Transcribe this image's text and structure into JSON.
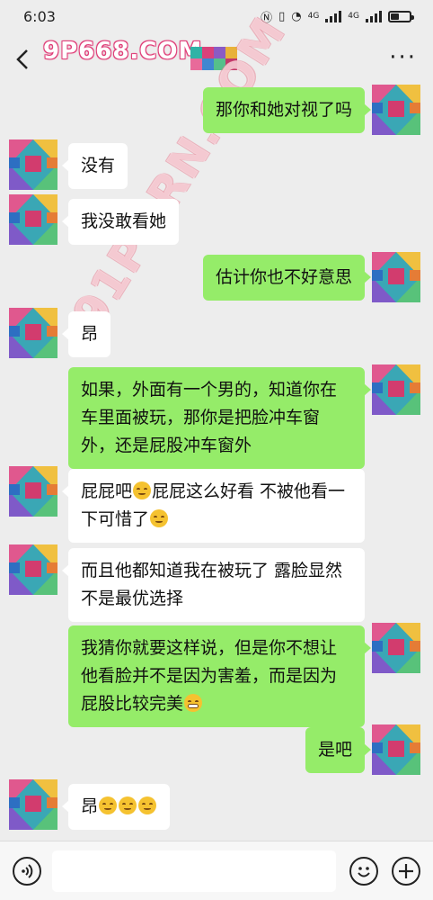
{
  "status_bar": {
    "time": "6:03",
    "icons": [
      "nfc-icon",
      "vibrate-icon",
      "wifi-icon",
      "4g-signal-icon",
      "4g-signal-icon",
      "battery-icon"
    ],
    "net_label_1": "4G",
    "net_label_2": "4G"
  },
  "nav": {
    "watermark": "9P668.COM",
    "more_label": "···"
  },
  "watermark_diagonal": "91PORN.COM",
  "messages": [
    {
      "side": "out",
      "text": "那你和她对视了吗"
    },
    {
      "side": "in",
      "text": "没有"
    },
    {
      "side": "in",
      "text": "我没敢看她"
    },
    {
      "side": "out",
      "text": "估计你也不好意思"
    },
    {
      "side": "in",
      "text": "昂"
    },
    {
      "side": "out",
      "text": "如果，外面有一个男的，知道你在车里面被玩，那你是把脸冲车窗外，还是屁股冲车窗外"
    },
    {
      "side": "in",
      "text_a": "屁屁吧",
      "text_b": "屁屁这么好看 不被他看一下可惜了"
    },
    {
      "side": "in",
      "text": "而且他都知道我在被玩了 露脸显然不是最优选择"
    },
    {
      "side": "out",
      "text": "我猜你就要这样说，但是你不想让他看脸并不是因为害羞，而是因为屁股比较完美"
    },
    {
      "side": "out",
      "text": "是吧"
    },
    {
      "side": "in",
      "text": "昂"
    }
  ],
  "input": {
    "placeholder": ""
  },
  "colors": {
    "background": "#ededed",
    "outgoing_bubble": "#95ec69",
    "incoming_bubble": "#ffffff"
  }
}
